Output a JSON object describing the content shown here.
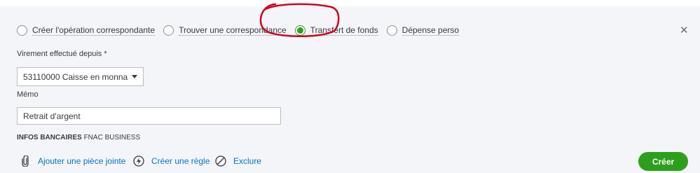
{
  "match_options": [
    {
      "label": "Créer l'opération correspondante",
      "checked": false
    },
    {
      "label": "Trouver une correspondance",
      "checked": false
    },
    {
      "label": "Transfert de fonds",
      "checked": true
    },
    {
      "label": "Dépense perso",
      "checked": false
    }
  ],
  "transfer_from": {
    "label": "Virement effectué depuis *",
    "value": "53110000 Caisse en monna"
  },
  "memo": {
    "label": "Mémo",
    "value": "Retrait d'argent"
  },
  "bank_info": {
    "heading": "INFOS BANCAIRES",
    "value": "FNAC BUSINESS"
  },
  "actions": {
    "attach": "Ajouter une pièce jointe",
    "rule": "Créer une règle",
    "exclude": "Exclure"
  },
  "create_button": "Créer",
  "colors": {
    "accent": "#2ca01c",
    "link": "#0077c5",
    "annotation": "#d0021b"
  }
}
